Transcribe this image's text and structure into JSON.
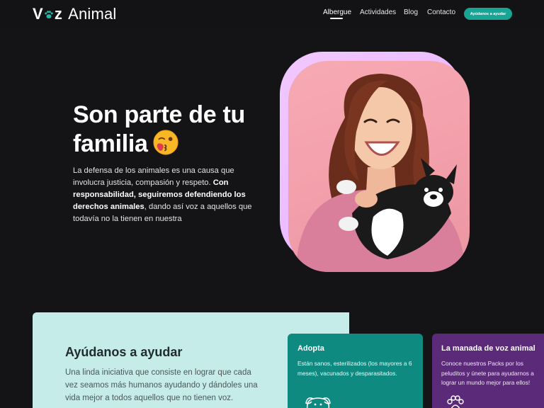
{
  "brand": {
    "logo_first": "V",
    "logo_mid": "z",
    "logo_rest": "Animal"
  },
  "nav": {
    "items": [
      {
        "label": "Albergue",
        "active": true
      },
      {
        "label": "Actividades",
        "active": false
      },
      {
        "label": "Blog",
        "active": false
      },
      {
        "label": "Contacto",
        "active": false
      }
    ],
    "cta_label": "Ayúdanos a ayudar"
  },
  "hero": {
    "title_line1": "Son parte de tu",
    "title_line2": "familia",
    "text_part1": "La defensa de los animales es una causa que involucra justicia, compasión y respeto. ",
    "text_bold": "Con responsabilidad, seguiremos defendiendo los derechos animales",
    "text_part2": ", dando así voz a aquellos que todavía no la tienen en nuestra"
  },
  "help": {
    "title": "Ayúdanos a ayudar",
    "text": "Una linda iniciativa que consiste en lograr que cada vez seamos más humanos ayudando y dándoles una vida mejor a todos aquellos que no tienen voz."
  },
  "cards": {
    "adopt": {
      "title": "Adopta",
      "text": "Están sanos, esterilizados (los mayores a 6 meses), vacunados y desparasitados.",
      "icon": "dog-icon"
    },
    "pack": {
      "title": "La manada de voz animal",
      "text": "Conoce nuestros Packs por los peluditos y únete para ayudarnos a lograr un mundo mejor para ellos!",
      "icon": "paw-icon"
    }
  },
  "colors": {
    "background": "#141416",
    "accent": "#17a596",
    "help_card": "#c6ecea",
    "adopt_card": "#0e8a80",
    "pack_card": "#5b2a78",
    "photo_frame": "#f2c7ff"
  }
}
